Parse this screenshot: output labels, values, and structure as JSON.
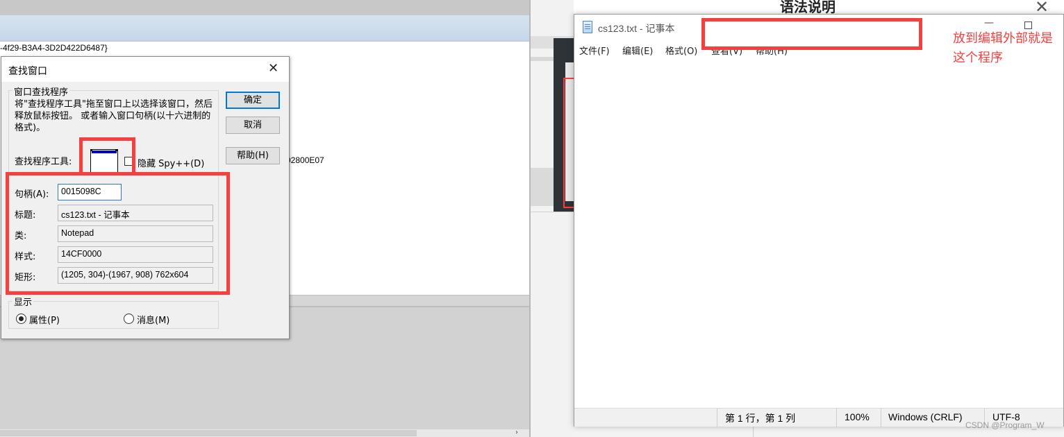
{
  "background_left": {
    "guid_fragment": "-4f29-B3A4-3D2D422D6487}",
    "value_fragment": "02800E07"
  },
  "background_right": {
    "heading": "语法说明",
    "close_glyph": "✕"
  },
  "notepad": {
    "title": "cs123.txt - 记事本",
    "menus": [
      "文件(F)",
      "编辑(E)",
      "格式(O)",
      "查看(V)",
      "帮助(H)"
    ],
    "status": {
      "position": "第 1 行，第 1 列",
      "zoom": "100%",
      "line_ending": "Windows (CRLF)",
      "encoding": "UTF-8"
    }
  },
  "annotation": {
    "text": "放到编辑外部就是这个程序",
    "color": "#f4403f"
  },
  "dialog": {
    "title": "查找窗口",
    "close_glyph": "✕",
    "finder_group_label": "窗口查找程序",
    "description": "将\"查找程序工具\"拖至窗口上以选择该窗口，然后释放鼠标按钮。 或者输入窗口句柄(以十六进制的格式)。",
    "finder_tool_label": "查找程序工具:",
    "hide_spy_label": "隐藏 Spy++(D)",
    "fields": {
      "handle_label": "句柄(A):",
      "handle_value": "0015098C",
      "caption_label": "标题:",
      "caption_value": "cs123.txt - 记事本",
      "class_label": "类:",
      "class_value": "Notepad",
      "style_label": "样式:",
      "style_value": "14CF0000",
      "rect_label": "矩形:",
      "rect_value": "(1205, 304)-(1967, 908) 762x604"
    },
    "buttons": {
      "ok": "确定",
      "cancel": "取消",
      "help": "帮助(H)"
    },
    "show_group_label": "显示",
    "radio_properties": "属性(P)",
    "radio_messages": "消息(M)",
    "selected_radio": "属性(P)"
  },
  "watermark": "CSDN @Program_W"
}
